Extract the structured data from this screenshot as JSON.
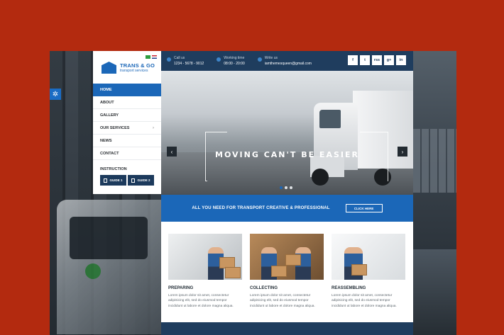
{
  "brand": {
    "name": "TRANS & GO",
    "tagline": "transport services"
  },
  "menu": [
    {
      "label": "HOME",
      "active": true
    },
    {
      "label": "ABOUT"
    },
    {
      "label": "GALLERY"
    },
    {
      "label": "OUR SERVICES",
      "has_submenu": true
    },
    {
      "label": "NEWS"
    },
    {
      "label": "CONTACT"
    }
  ],
  "instruction": {
    "title": "INSTRUCTION",
    "guides": [
      "GUIDE 1",
      "GUIDE 2"
    ]
  },
  "topbar": {
    "call_label": "Call us",
    "call_value": "1234 - 5678 - 9012",
    "hours_label": "Working time",
    "hours_value": "08:00 - 20:00",
    "mail_label": "Write us",
    "mail_value": "iamthemesqueen@gmail.com",
    "socials": [
      "f",
      "t",
      "rss",
      "g+",
      "in"
    ]
  },
  "hero": {
    "title": "MOVING CAN'T BE EASIER"
  },
  "cta": {
    "text": "ALL YOU NEED FOR TRANSPORT CREATIVE & PROFESSIONAL",
    "button": "CLICK HERE"
  },
  "services": [
    {
      "title": "PREPARING",
      "text": "Lorem ipsum dolor sit amet, consectetur adipisicing elit, sed do eiusmod tempor incididunt ut labore et dolore magna aliqua."
    },
    {
      "title": "COLLECTING",
      "text": "Lorem ipsum dolor sit amet, consectetur adipisicing elit, sed do eiusmod tempor incididunt ut labore et dolore magna aliqua."
    },
    {
      "title": "REASSEMBLING",
      "text": "Lorem ipsum dolor sit amet, consectetur adipisicing elit, sed do eiusmod tempor incididunt ut labore et dolore magna aliqua."
    }
  ],
  "colors": {
    "background": "#b32a0f",
    "primary": "#1b67b8",
    "dark_navy": "#1f3d5e"
  }
}
